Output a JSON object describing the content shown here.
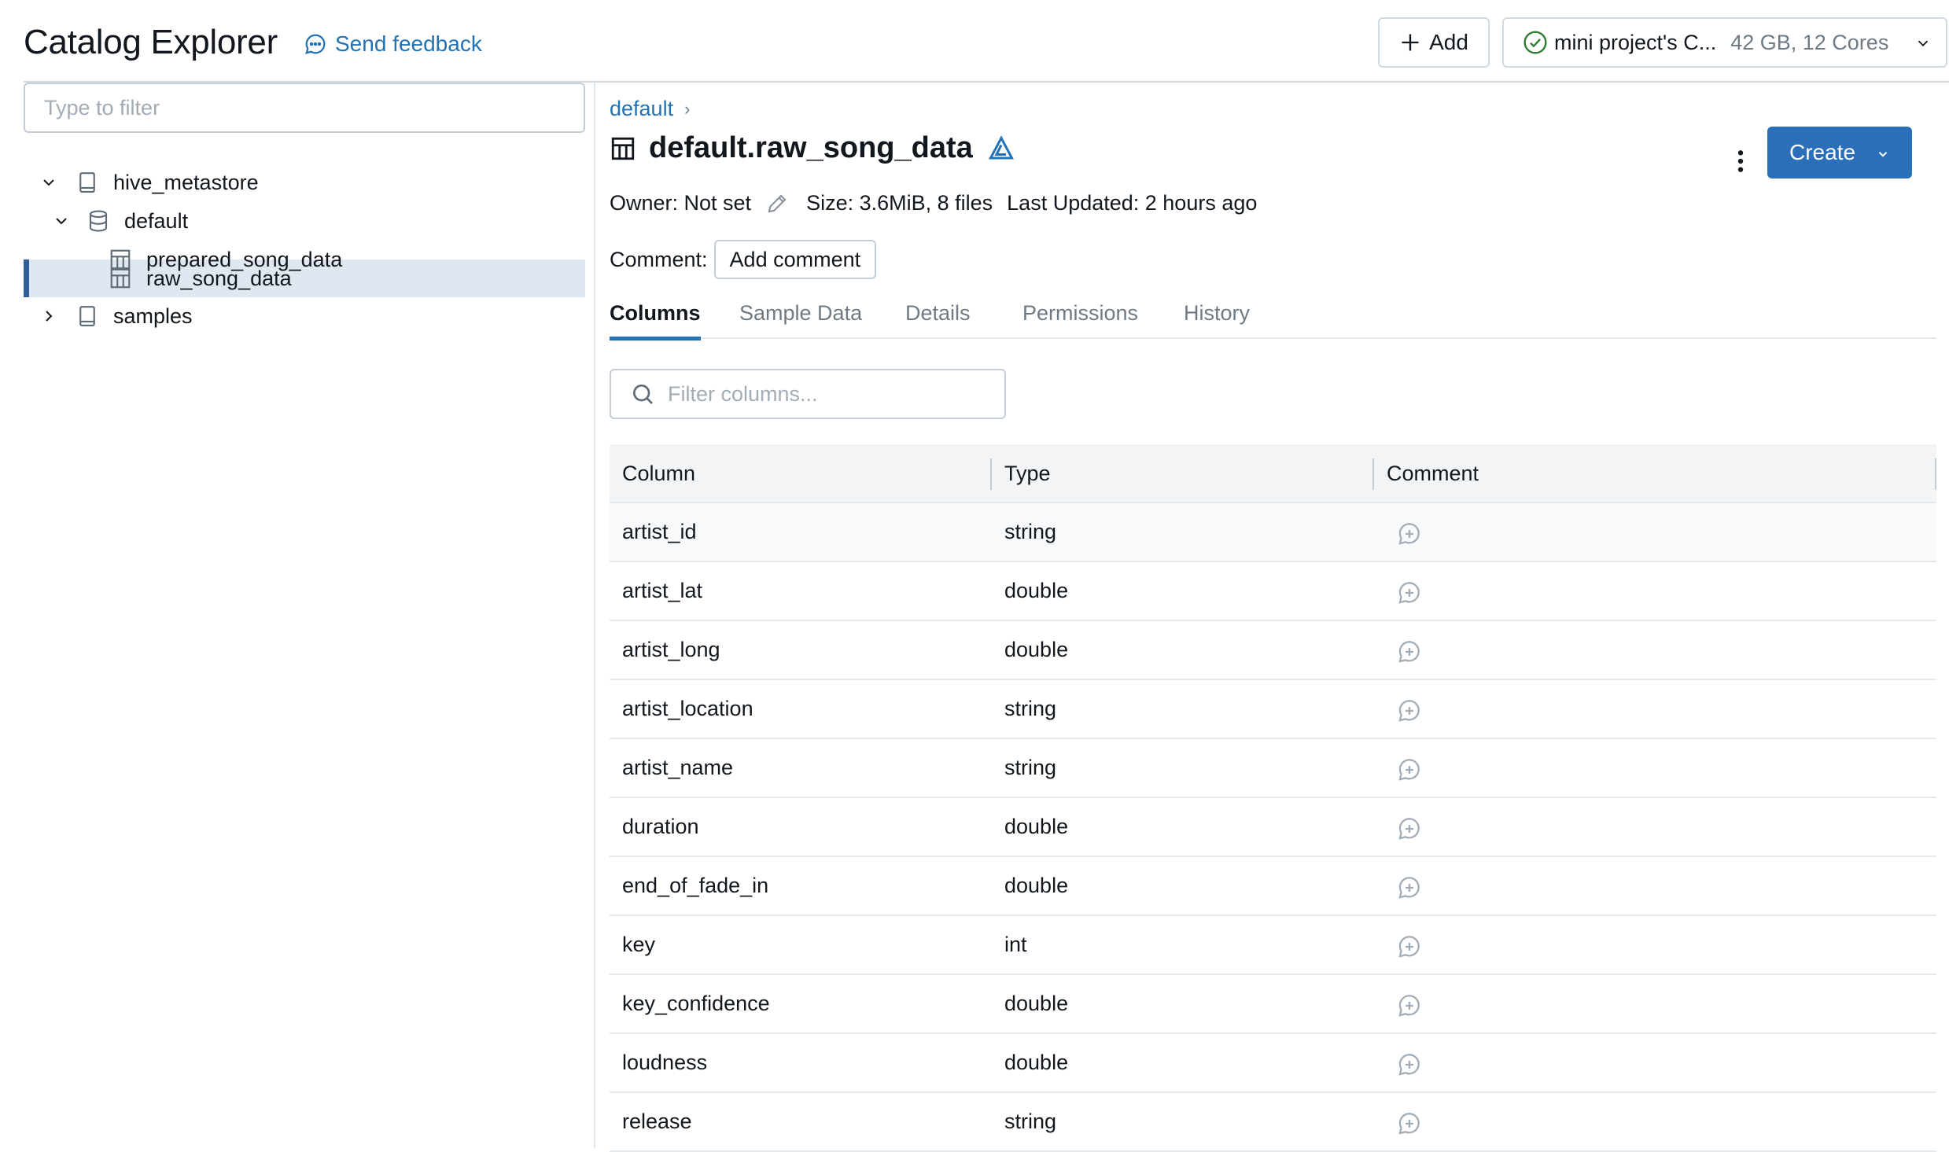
{
  "header": {
    "title": "Catalog Explorer",
    "feedback_label": "Send feedback",
    "add_label": "Add",
    "cluster_name": "mini project's C...",
    "cluster_spec": "42 GB, 12 Cores"
  },
  "sidebar": {
    "filter_placeholder": "Type to filter",
    "tree": {
      "hive_metastore": "hive_metastore",
      "default": "default",
      "prepared_song_data": "prepared_song_data",
      "raw_song_data": "raw_song_data",
      "samples": "samples"
    }
  },
  "main": {
    "breadcrumb": "default",
    "table_name": "default.raw_song_data",
    "owner": "Owner: Not set",
    "size": "Size: 3.6MiB, 8 files",
    "last_updated": "Last Updated: 2 hours ago",
    "comment_label": "Comment:",
    "add_comment": "Add comment",
    "create_label": "Create",
    "tabs": {
      "columns": "Columns",
      "sample_data": "Sample Data",
      "details": "Details",
      "permissions": "Permissions",
      "history": "History"
    },
    "filter_columns_placeholder": "Filter columns...",
    "grid_headers": {
      "column": "Column",
      "type": "Type",
      "comment": "Comment"
    },
    "rows": [
      {
        "name": "artist_id",
        "type": "string"
      },
      {
        "name": "artist_lat",
        "type": "double"
      },
      {
        "name": "artist_long",
        "type": "double"
      },
      {
        "name": "artist_location",
        "type": "string"
      },
      {
        "name": "artist_name",
        "type": "string"
      },
      {
        "name": "duration",
        "type": "double"
      },
      {
        "name": "end_of_fade_in",
        "type": "double"
      },
      {
        "name": "key",
        "type": "int"
      },
      {
        "name": "key_confidence",
        "type": "double"
      },
      {
        "name": "loudness",
        "type": "double"
      },
      {
        "name": "release",
        "type": "string"
      }
    ]
  },
  "colors": {
    "accent": "#2272b4",
    "primary_button": "#2a6fb8",
    "selected_row": "#dfe7f1",
    "success": "#2e7d32"
  }
}
